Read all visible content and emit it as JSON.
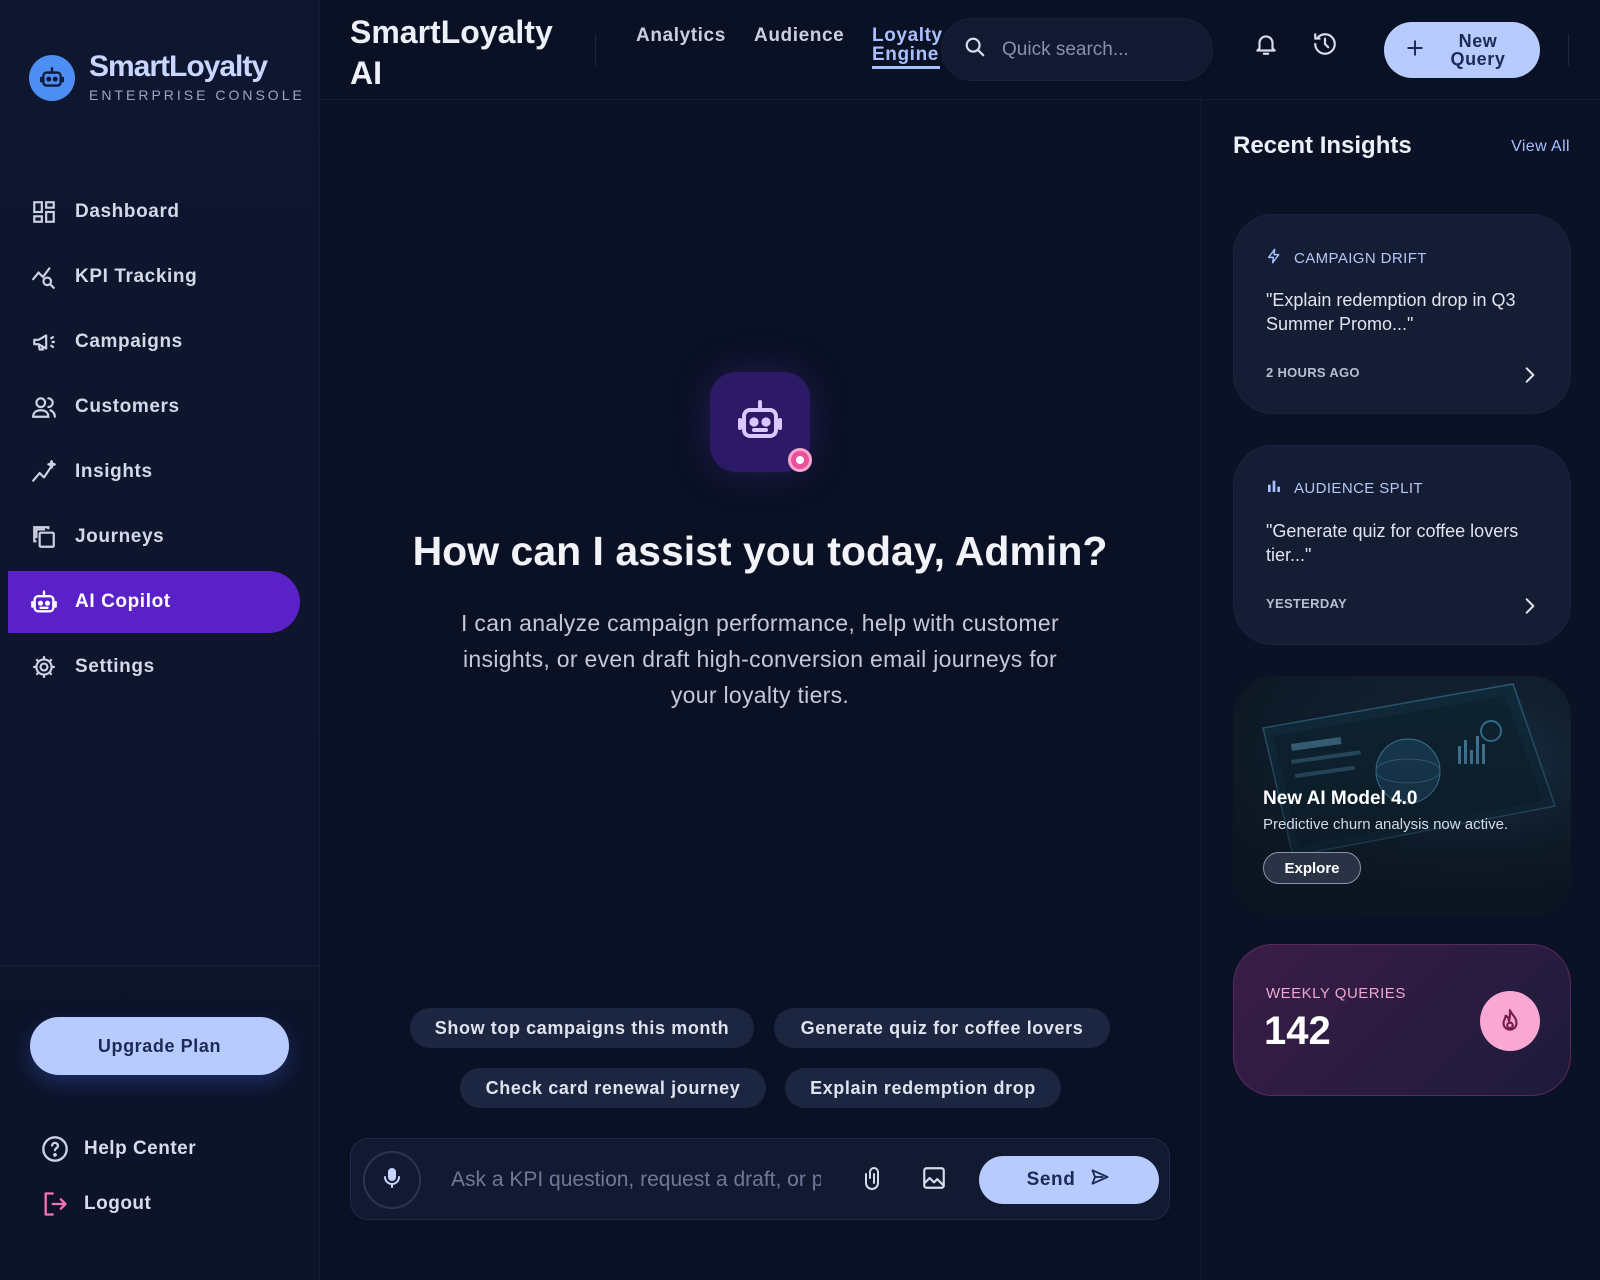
{
  "brand": {
    "name": "SmartLoyalty",
    "subtitle": "ENTERPRISE CONSOLE"
  },
  "sidebar": {
    "items": [
      {
        "label": "Dashboard",
        "icon": "dashboard-icon"
      },
      {
        "label": "KPI Tracking",
        "icon": "kpi-tracking-icon"
      },
      {
        "label": "Campaigns",
        "icon": "megaphone-icon"
      },
      {
        "label": "Customers",
        "icon": "users-icon"
      },
      {
        "label": "Insights",
        "icon": "insights-icon"
      },
      {
        "label": "Journeys",
        "icon": "journeys-icon"
      },
      {
        "label": "AI Copilot",
        "icon": "robot-icon",
        "active": true
      },
      {
        "label": "Settings",
        "icon": "gear-icon"
      }
    ],
    "upgrade_label": "Upgrade Plan",
    "help_label": "Help Center",
    "logout_label": "Logout"
  },
  "header": {
    "title": "SmartLoyalty AI",
    "tabs": [
      {
        "label": "Analytics"
      },
      {
        "label": "Audience"
      },
      {
        "label": "Loyalty Engine",
        "active": true
      }
    ],
    "search_placeholder": "Quick search...",
    "new_query_label": "New Query"
  },
  "main": {
    "greeting": "How can I assist you today, Admin?",
    "description": "I can analyze campaign performance, help with customer insights, or even draft high-conversion email journeys for your loyalty tiers.",
    "suggestions": [
      "Show top campaigns this month",
      "Generate quiz for coffee lovers",
      "Check card renewal journey",
      "Explain redemption drop"
    ],
    "composer_placeholder": "Ask a KPI question, request a draft, or paste data...",
    "send_label": "Send"
  },
  "rail": {
    "title": "Recent Insights",
    "view_all": "View All",
    "insights": [
      {
        "tag": "CAMPAIGN DRIFT",
        "icon": "bolt-icon",
        "quote": "\"Explain redemption drop in Q3 Summer Promo...\"",
        "time": "2 HOURS AGO"
      },
      {
        "tag": "AUDIENCE SPLIT",
        "icon": "bar-chart-icon",
        "quote": "\"Generate quiz for coffee lovers tier...\"",
        "time": "YESTERDAY"
      }
    ],
    "promo": {
      "title": "New AI Model 4.0",
      "subtitle": "Predictive churn analysis now active.",
      "button": "Explore"
    },
    "weekly": {
      "label": "WEEKLY QUERIES",
      "value": "142",
      "icon": "fire-icon"
    }
  },
  "colors": {
    "accent": "#b8cbff",
    "active_nav": "#5b21c9",
    "notification_dot": "#ec4f9c",
    "background": "#0a1124"
  }
}
